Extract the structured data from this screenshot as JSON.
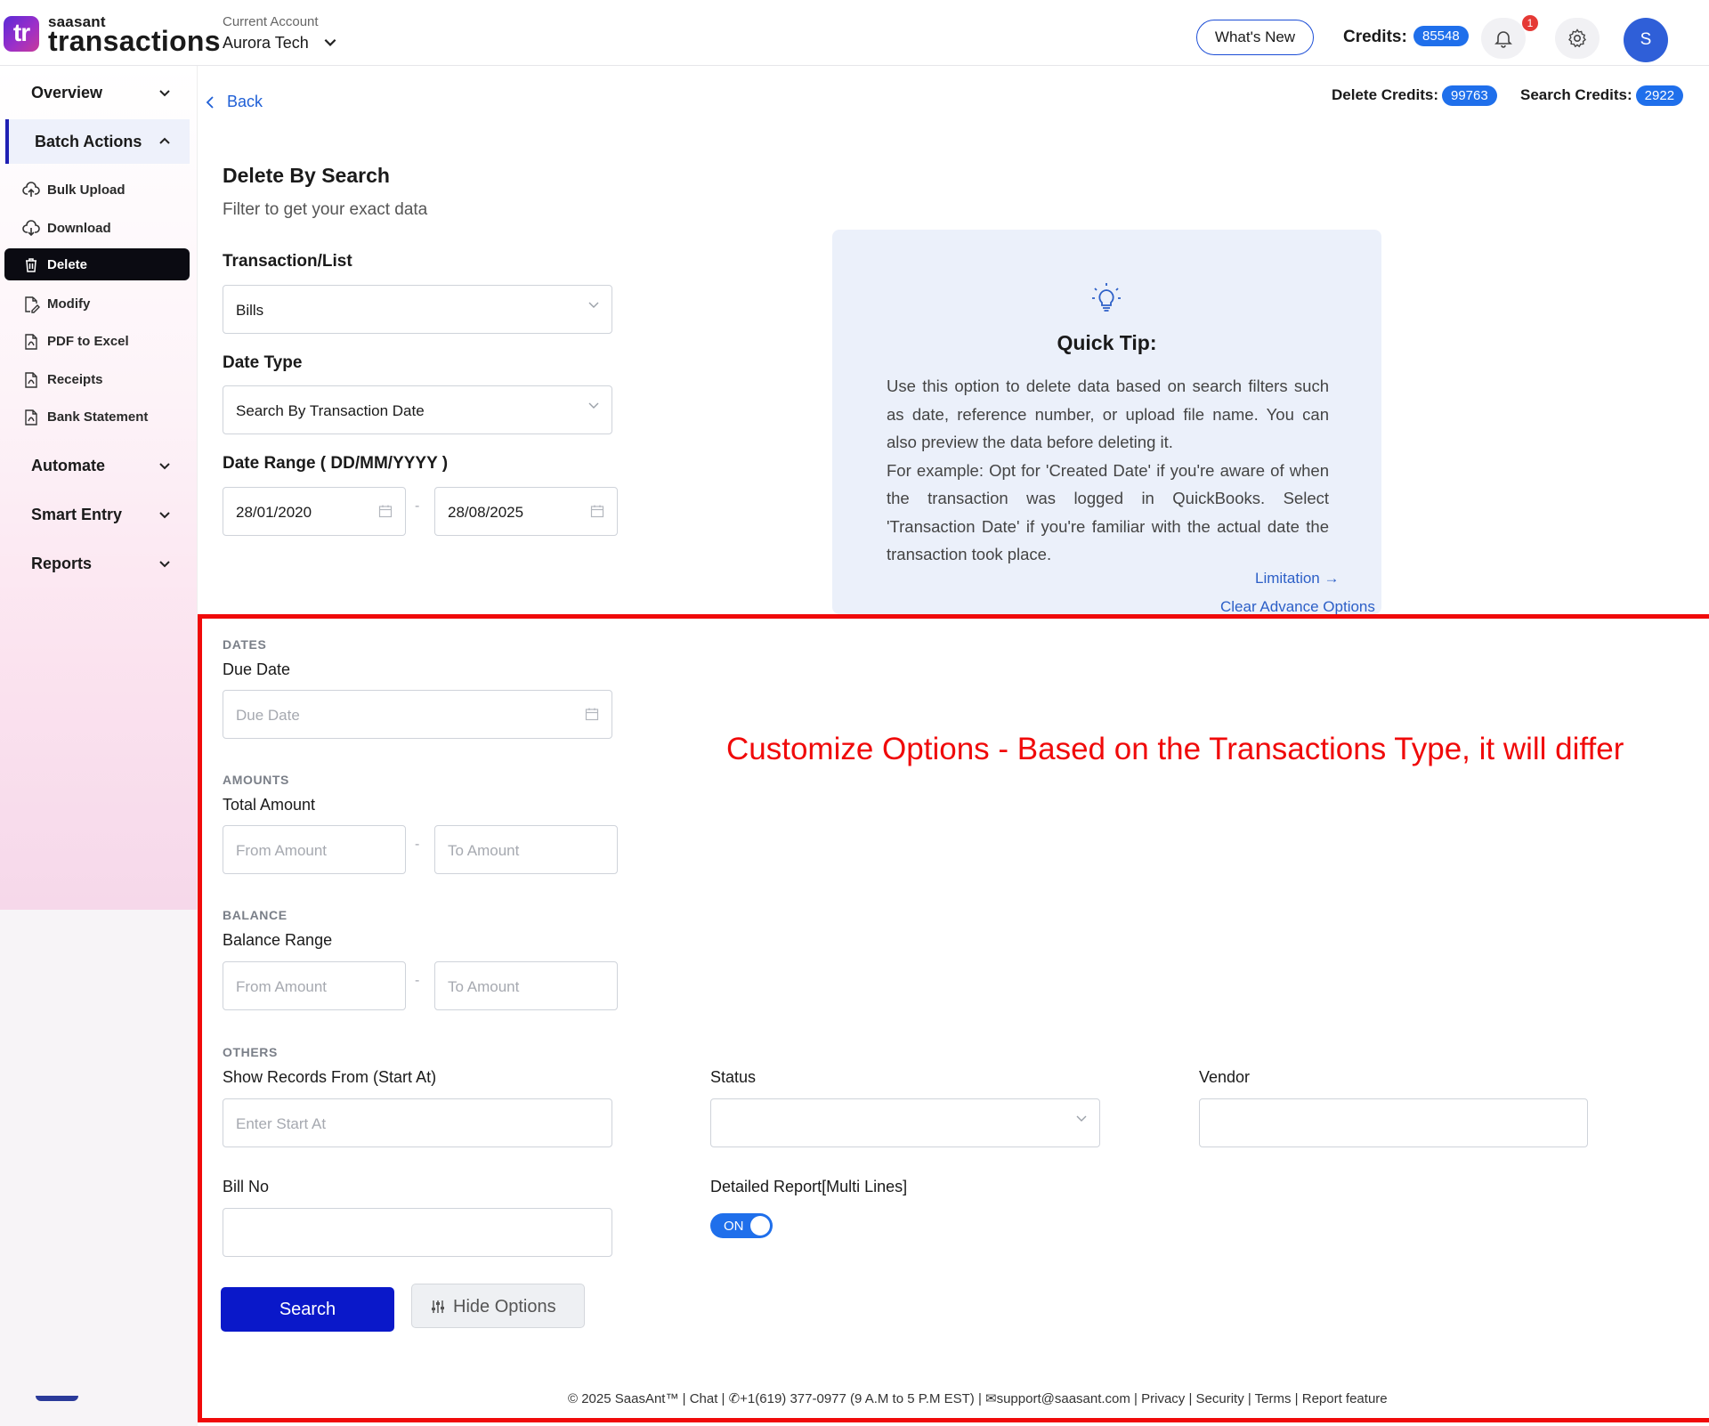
{
  "brand": {
    "logo_mark": "tr",
    "small": "saasant",
    "name": "transactions"
  },
  "account": {
    "caption": "Current Account",
    "name": "Aurora Tech"
  },
  "header": {
    "whats_new": "What's New",
    "credits_label": "Credits:",
    "credits_value": "85548",
    "notification_count": "1",
    "avatar_initial": "S"
  },
  "sidebar": {
    "overview": "Overview",
    "batch_actions": "Batch Actions",
    "items": [
      "Bulk Upload",
      "Download",
      "Delete",
      "Modify",
      "PDF to Excel",
      "Receipts",
      "Bank Statement"
    ],
    "automate": "Automate",
    "smart_entry": "Smart Entry",
    "reports": "Reports"
  },
  "main": {
    "back": "Back",
    "delete_credits_label": "Delete Credits:",
    "delete_credits_value": "99763",
    "search_credits_label": "Search Credits:",
    "search_credits_value": "2922",
    "title": "Delete By Search",
    "subtitle": "Filter to get your exact data",
    "transaction_label": "Transaction/List",
    "transaction_value": "Bills",
    "date_type_label": "Date Type",
    "date_type_value": "Search By Transaction Date",
    "date_range_label": "Date Range ( DD/MM/YYYY )",
    "date_from": "28/01/2020",
    "date_to": "28/08/2025",
    "range_dash": "-"
  },
  "tip": {
    "title": "Quick Tip:",
    "line1": "Use this option to delete data based on search filters such as date, reference number, or upload file name. You can also preview the data before deleting it.",
    "line2": "For example: Opt for 'Created Date' if you're aware of when the transaction was logged in QuickBooks. Select 'Transaction Date' if you're familiar with the actual date the transaction took place.",
    "limitation": "Limitation →",
    "clear_advance": "Clear Advance Options"
  },
  "annotation": "Customize Options - Based on the Transactions Type, it will differ",
  "advanced": {
    "dates_caption": "DATES",
    "due_date_label": "Due Date",
    "due_date_placeholder": "Due Date",
    "amounts_caption": "AMOUNTS",
    "total_amount_label": "Total Amount",
    "from_amount_placeholder": "From Amount",
    "to_amount_placeholder": "To Amount",
    "balance_caption": "BALANCE",
    "balance_range_label": "Balance Range",
    "others_caption": "OTHERS",
    "start_at_label": "Show Records From (Start At)",
    "start_at_placeholder": "Enter Start At",
    "status_label": "Status",
    "vendor_label": "Vendor",
    "bill_no_label": "Bill No",
    "detailed_report_label": "Detailed Report[Multi Lines]",
    "toggle_state": "ON"
  },
  "actions": {
    "search": "Search",
    "hide_options": "Hide Options"
  },
  "footer": "© 2025 SaasAnt™  | Chat  |  ✆+1(619) 377-0977 (9 A.M to 5 P.M EST)  |  ✉support@saasant.com  | Privacy  | Security  | Terms  | Report feature",
  "colors": {
    "accent": "#1f6feb",
    "primary_button": "#0a18c9",
    "annotation": "#f00a0a",
    "tip_bg": "#ebf0fa"
  }
}
